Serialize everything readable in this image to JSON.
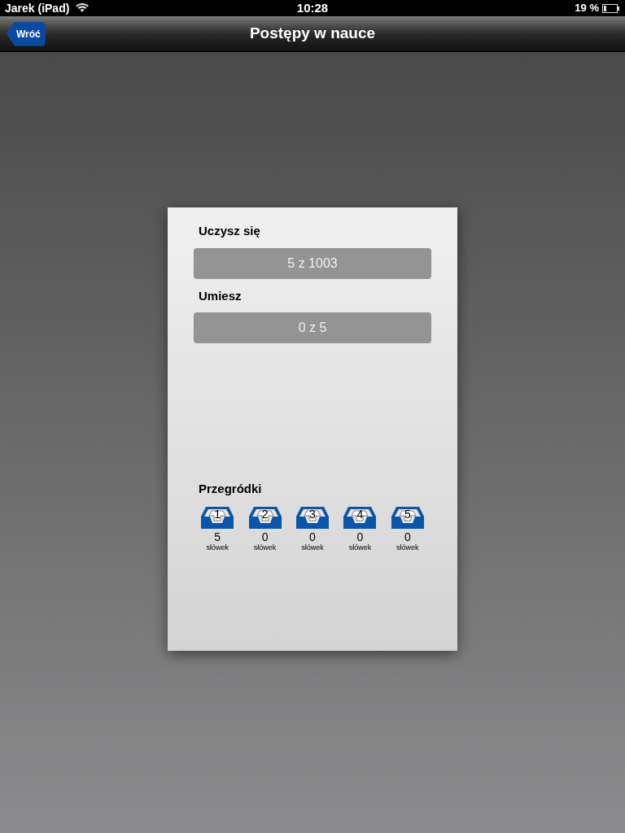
{
  "status_bar": {
    "carrier": "Jarek (iPad)",
    "time": "10:28",
    "battery": "19 %"
  },
  "nav_bar": {
    "back": "Wróć",
    "title": "Postępy w nauce"
  },
  "progress": [
    {
      "label": "Uczysz się",
      "reading": "5 z 1003"
    },
    {
      "label": "Umiesz",
      "reading": "0 z 5"
    }
  ],
  "bins": {
    "title": "Przegródki",
    "items": [
      {
        "number": "1",
        "count": "5",
        "unit": "słówek"
      },
      {
        "number": "2",
        "count": "0",
        "unit": "słówek"
      },
      {
        "number": "3",
        "count": "0",
        "unit": "słówek"
      },
      {
        "number": "4",
        "count": "0",
        "unit": "słówek"
      },
      {
        "number": "5",
        "count": "0",
        "unit": "słówek"
      }
    ]
  }
}
